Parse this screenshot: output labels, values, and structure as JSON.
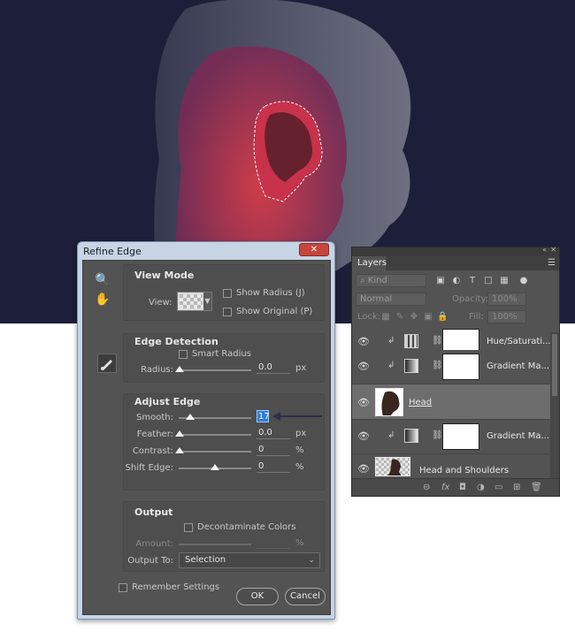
{
  "dialog": {
    "title": "Refine Edge",
    "close": "✕",
    "view_mode": {
      "title": "View Mode",
      "view_label": "View:",
      "show_radius": "Show Radius (J)",
      "show_original": "Show Original (P)"
    },
    "edge_detection": {
      "title": "Edge Detection",
      "smart_radius": "Smart Radius",
      "radius_label": "Radius:",
      "radius_value": "0.0",
      "radius_unit": "px"
    },
    "adjust_edge": {
      "title": "Adjust Edge",
      "smooth_label": "Smooth:",
      "smooth_value": "17",
      "feather_label": "Feather:",
      "feather_value": "0.0",
      "feather_unit": "px",
      "contrast_label": "Contrast:",
      "contrast_value": "0",
      "contrast_unit": "%",
      "shift_label": "Shift Edge:",
      "shift_value": "0",
      "shift_unit": "%"
    },
    "output": {
      "title": "Output",
      "decontaminate": "Decontaminate Colors",
      "amount_label": "Amount:",
      "amount_unit": "%",
      "output_to_label": "Output To:",
      "output_to_value": "Selection"
    },
    "remember": "Remember Settings",
    "ok": "OK",
    "cancel": "Cancel"
  },
  "layers_panel": {
    "tab": "Layers",
    "filter_kind": "Kind",
    "blend_mode": "Normal",
    "opacity_label": "Opacity:",
    "opacity_value": "100%",
    "lock_label": "Lock:",
    "fill_label": "Fill:",
    "fill_value": "100%",
    "layers": [
      {
        "name": "Hue/Saturati..."
      },
      {
        "name": "Gradient Ma..."
      },
      {
        "name": "Head"
      },
      {
        "name": "Gradient Ma..."
      },
      {
        "name": "Head and Shoulders"
      }
    ],
    "footer_icons": [
      "link-icon",
      "fx-icon",
      "mask-icon",
      "adjustment-icon",
      "folder-icon",
      "new-layer-icon",
      "trash-icon"
    ],
    "footer_glyphs": [
      "⊖",
      "fx",
      "◘",
      "◑",
      "▭",
      "⊞",
      "🗑"
    ]
  }
}
